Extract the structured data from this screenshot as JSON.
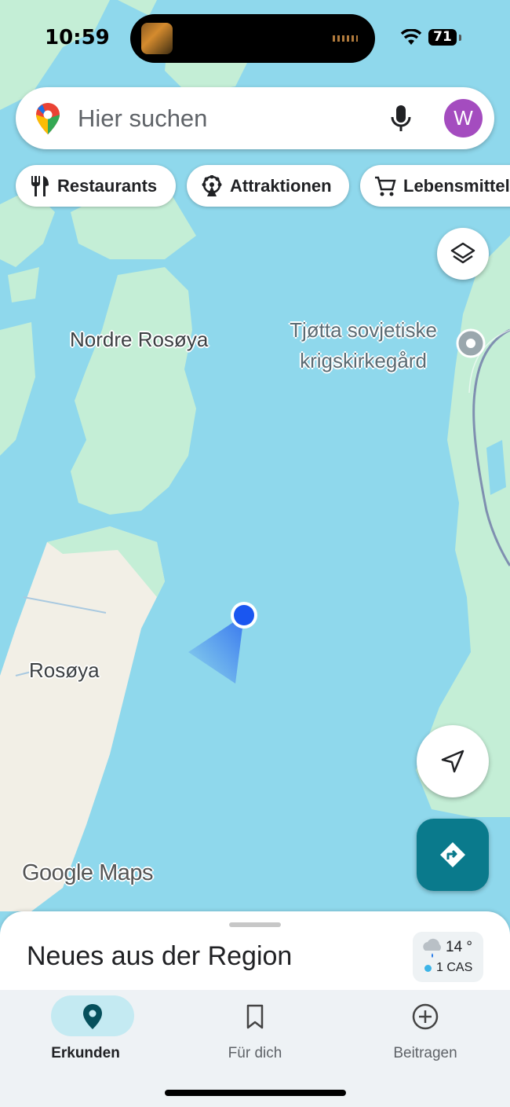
{
  "status_bar": {
    "time": "10:59",
    "battery": "71"
  },
  "search": {
    "placeholder": "Hier suchen",
    "avatar_letter": "W"
  },
  "chips": [
    {
      "label": "Restaurants",
      "icon": "fork-knife-icon"
    },
    {
      "label": "Attraktionen",
      "icon": "attraction-icon"
    },
    {
      "label": "Lebensmittel",
      "icon": "cart-icon"
    }
  ],
  "map": {
    "labels": {
      "nordre": "Nordre Rosøya",
      "rosoya": "Rosøya",
      "poi_line1": "Tjøtta sovjetiske",
      "poi_line2": "krigskirkegård"
    },
    "logo": "Google Maps",
    "colors": {
      "water": "#8fd8ec",
      "land": "#c4eed6",
      "sand": "#f2efe6",
      "location": "#1a56f0",
      "directions": "#0a7a8c"
    }
  },
  "sheet": {
    "title": "Neues aus der Region",
    "weather": {
      "temp": "14 °",
      "aqi": "1 CAS"
    }
  },
  "nav": {
    "explore": "Erkunden",
    "for_you": "Für dich",
    "contribute": "Beitragen"
  }
}
